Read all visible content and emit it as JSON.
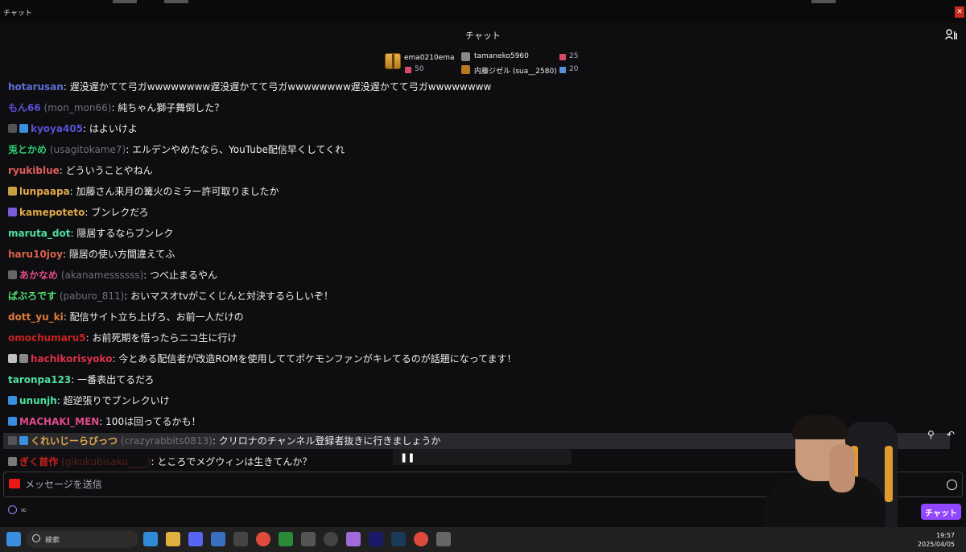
{
  "window": {
    "title": "チャット"
  },
  "header": {
    "title": "チャット"
  },
  "leaderboard": {
    "top": {
      "name": "ema0210ema",
      "count": "50"
    },
    "entries": [
      {
        "name": "tamaneko5960",
        "count": "25"
      },
      {
        "name": "内藤ジゼル (sua__2580)",
        "count": "20"
      }
    ]
  },
  "messages": [
    {
      "user": "hotarusan",
      "handle": "",
      "text": ": 遅没遅かてて弓ガwwwwwwww遅没遅かてて弓ガwwwwwwww遅没遅かてて弓ガwwwwwwww",
      "color": "#5f6fd8"
    },
    {
      "user": "もん66",
      "handle": " (mon_mon66)",
      "text": ": 純ちゃん獅子舞倒した？",
      "color": "#5b4fd6"
    },
    {
      "user": "kyoya405",
      "handle": "",
      "text": ": はよいけよ",
      "color": "#5b4fd6"
    },
    {
      "user": "兎とかめ",
      "handle": " (usagitokame7)",
      "text": ": エルデンやめたなら、YouTube配信早くしてくれ",
      "color": "#2ecc71"
    },
    {
      "user": "ryukiblue",
      "handle": "",
      "text": ": どういうことやねん",
      "color": "#e05d5d"
    },
    {
      "user": "lunpaapa",
      "handle": "",
      "text": ": 加藤さん来月の篝火のミラー許可取りましたか",
      "color": "#e0a84a"
    },
    {
      "user": "kamepoteto",
      "handle": "",
      "text": ": ブンレクだろ",
      "color": "#e0a84a"
    },
    {
      "user": "maruta_dot",
      "handle": "",
      "text": ": 隠居するならブンレク",
      "color": "#4ee0a0"
    },
    {
      "user": "haru10joy",
      "handle": "",
      "text": ": 隠居の使い方間違えてふ",
      "color": "#d9614a"
    },
    {
      "user": "あかなめ",
      "handle": " (akanamessssss)",
      "text": ": つべ止まるやん",
      "color": "#e04a8a"
    },
    {
      "user": "ぱぶろです",
      "handle": " (paburo_811)",
      "text": ": おいマスオtvがこくじんと対決するらしいぞ！",
      "color": "#4ee070"
    },
    {
      "user": "dott_yu_ki",
      "handle": "",
      "text": ": 配信サイト立ち上げろ、お前一人だけの",
      "color": "#e07a3a"
    },
    {
      "user": "omochumaru5",
      "handle": "",
      "text": ": お前死期を悟ったらニコ生に行け",
      "color": "#cc2020"
    },
    {
      "user": "hachikorisyoko",
      "handle": "",
      "text": ": 今とある配信者が改造ROMを使用しててポケモンファンがキレてるのが話題になってます！",
      "color": "#e0304a"
    },
    {
      "user": "taronpa123",
      "handle": "",
      "text": ": 一番表出てるだろ",
      "color": "#4ee0a0"
    },
    {
      "user": "ununjh",
      "handle": "",
      "text": ": 超逆張りでブンレクいけ",
      "color": "#4ee0a0"
    },
    {
      "user": "MACHAKI_MEN",
      "handle": "",
      "text": ": 100は回ってるかも！",
      "color": "#e04a8a"
    },
    {
      "user": "くれいじーらびっつ",
      "handle": " (crazyrabbits0813)",
      "text": ": クリロナのチャンネル登録者抜きに行きましょうか",
      "color": "#e0a84a"
    },
    {
      "user": "ぎく首作",
      "handle": " (gikukubisaku____)",
      "text": ": ところでメグウィンは生きてんか？",
      "color": "#cc2020"
    }
  ],
  "input": {
    "placeholder": "メッセージを送信"
  },
  "points": {
    "value": "∞"
  },
  "send_button": {
    "label": "チャット"
  },
  "taskbar": {
    "search_label": "検索",
    "time": "19:57",
    "date": "2025/04/05"
  }
}
